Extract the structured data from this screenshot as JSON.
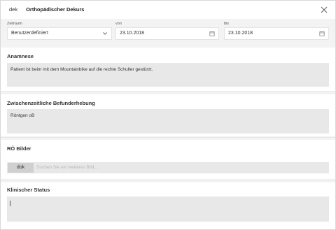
{
  "header": {
    "tab_short": "dek",
    "tab_title": "Orthopädischer Dekurs",
    "close_icon": "close-icon"
  },
  "period": {
    "range_label": "Zeitraum",
    "range_value": "Benutzerdefiniert",
    "from_label": "von",
    "from_value": "23.10.2018",
    "to_label": "bis",
    "to_value": "23.10.2018"
  },
  "sections": {
    "anamnese": {
      "title": "Anamnese",
      "text": "Patient ist beim mit dem Mountainbike auf die rechte Schulter gestürzt."
    },
    "befund": {
      "title": "Zwischenzeitliche Befunderhebung",
      "text": "Röntgen oB"
    },
    "bilder": {
      "title": "RÖ Bilder",
      "tag": "dok",
      "placeholder": "Suchen Sie ein weiteres Bild..."
    },
    "status": {
      "title": "Klinischer Status",
      "text": ""
    }
  }
}
